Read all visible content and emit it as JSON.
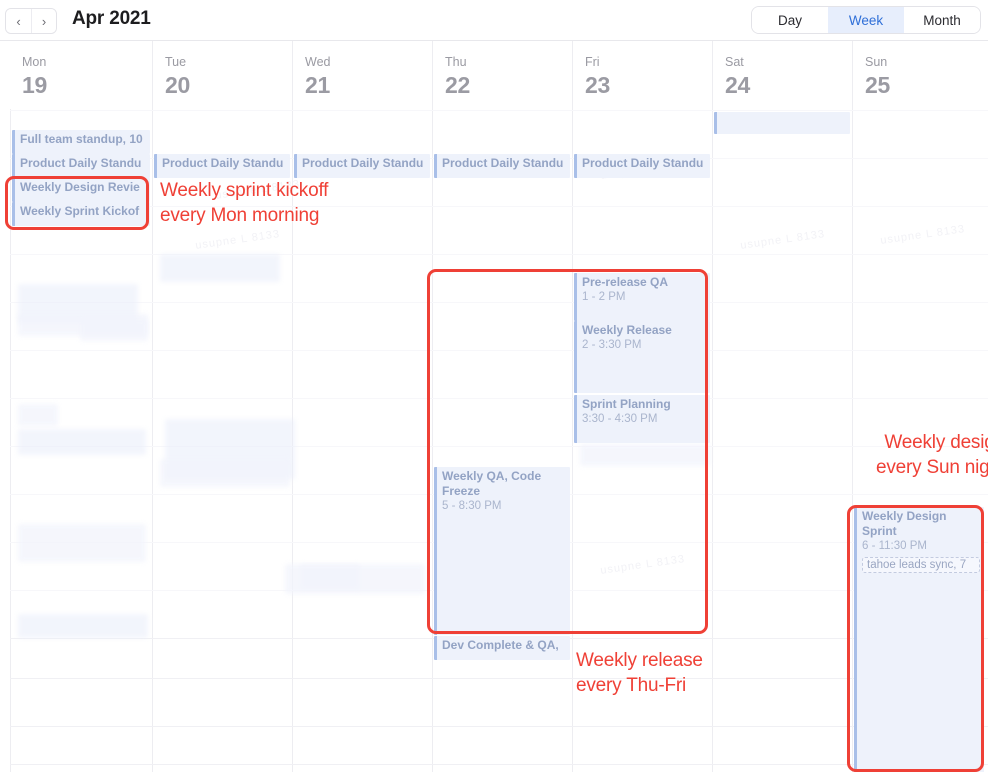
{
  "header": {
    "prev_icon": "‹",
    "next_icon": "›",
    "title": "Apr 2021",
    "views": [
      {
        "label": "Day",
        "active": false
      },
      {
        "label": "Week",
        "active": true
      },
      {
        "label": "Month",
        "active": false
      }
    ]
  },
  "days": [
    {
      "dow": "Mon",
      "num": "19"
    },
    {
      "dow": "Tue",
      "num": "20"
    },
    {
      "dow": "Wed",
      "num": "21"
    },
    {
      "dow": "Thu",
      "num": "22"
    },
    {
      "dow": "Fri",
      "num": "23"
    },
    {
      "dow": "Sat",
      "num": "24"
    },
    {
      "dow": "Sun",
      "num": "25"
    }
  ],
  "events": {
    "mon_full_standup": {
      "title": "Full team standup, 10"
    },
    "mon_daily": {
      "title": "Product Daily Standu"
    },
    "mon_design_review": {
      "title": "Weekly Design Revie"
    },
    "mon_sprint_kickoff": {
      "title": "Weekly Sprint Kickof"
    },
    "tue_daily": {
      "title": "Product Daily Standu"
    },
    "wed_daily": {
      "title": "Product Daily Standu"
    },
    "thu_daily": {
      "title": "Product Daily Standu"
    },
    "fri_daily": {
      "title": "Product Daily Standu"
    },
    "fri_prerelease_qa": {
      "title": "Pre-release QA",
      "time": "1 - 2 PM"
    },
    "fri_weekly_release": {
      "title": "Weekly Release",
      "time": "2 - 3:30 PM"
    },
    "fri_sprint_planning": {
      "title": "Sprint Planning",
      "time": "3:30 - 4:30 PM"
    },
    "thu_weekly_qa": {
      "title": "Weekly QA, Code Freeze",
      "time": "5 - 8:30 PM"
    },
    "thu_dev_complete": {
      "title": "Dev Complete & QA,"
    },
    "sun_design_sprint": {
      "title": "Weekly Design Sprint",
      "time": "6 - 11:30 PM",
      "chip": "tahoe leads sync, 7"
    }
  },
  "annotations": {
    "sprint_kickoff": "Weekly sprint kickoff\never Mon morning",
    "sprint_kickoff_line1": "Weekly sprint kickoff",
    "sprint_kickoff_line2": "every Mon morning",
    "design_line1": "Weekly design",
    "design_line2": "every Sun night",
    "release_line1": "Weekly release",
    "release_line2": "every Thu-Fri"
  },
  "colors": {
    "accent_red": "#ef4036",
    "event_blue": "#a9bfe8",
    "event_bg": "#eef2fb",
    "active_tab": "#2f6fd8"
  },
  "watermarks": [
    "usupne L 8133",
    "usupne L 8133",
    "usupne L 8133",
    "usupne L 8133",
    "usupne L 8133",
    "usupne L 8133"
  ]
}
